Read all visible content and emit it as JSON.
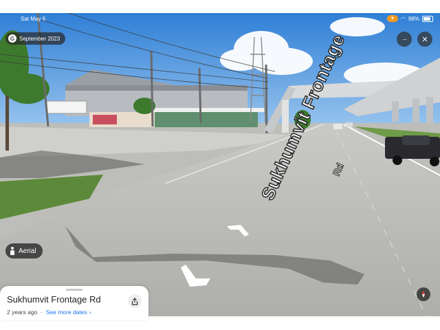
{
  "status_bar": {
    "time": "Sat May 6",
    "mic": "",
    "battery": "98%"
  },
  "capture_chip": {
    "icon": "google-g-icon",
    "date": "September 2023"
  },
  "top_buttons": {
    "more_icon": "···",
    "close_icon": "✕"
  },
  "road_label": {
    "name": "Sukhumvit Frontage",
    "suffix": "Rd"
  },
  "aerial": {
    "label": "Aerial"
  },
  "compass": {
    "icon": "compass-icon"
  },
  "info_card": {
    "title": "Sukhumvit Frontage Rd",
    "age": "2 years ago",
    "link": "See more dates",
    "chevron": "›",
    "share_icon": "share-icon"
  },
  "colors": {
    "sky": "#3b88d8",
    "road": "#b9b9b7",
    "link": "#1a73e8",
    "mic_pill": "#f39a1e"
  }
}
